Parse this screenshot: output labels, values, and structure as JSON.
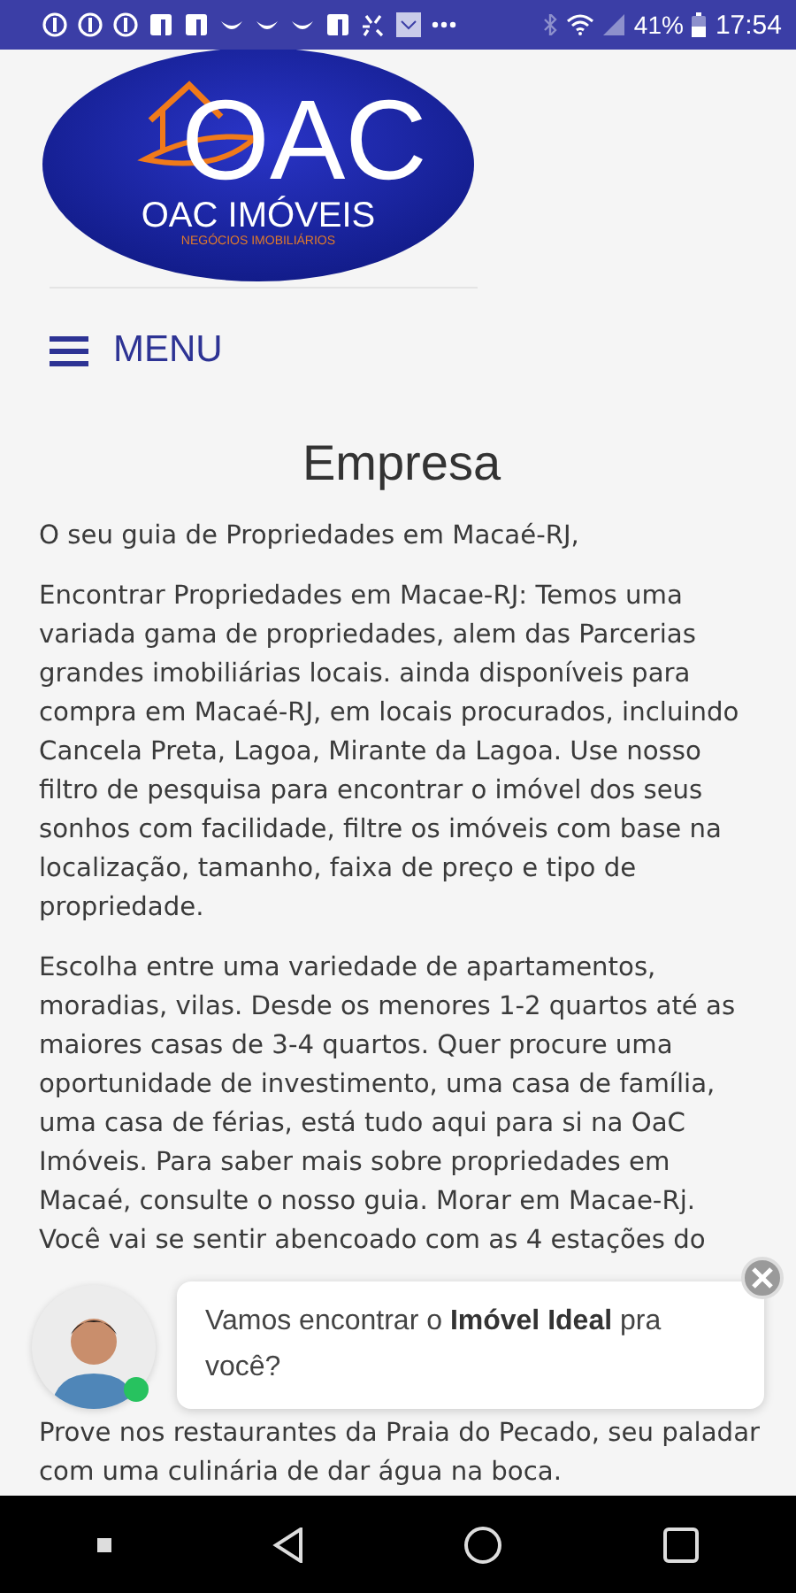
{
  "status_bar": {
    "battery": "41%",
    "time": "17:54"
  },
  "logo": {
    "mark": "OAC",
    "name": "OAC IMÓVEIS",
    "tagline": "NEGÓCIOS IMOBILIÁRIOS"
  },
  "menu": {
    "label": "MENU"
  },
  "page": {
    "title": "Empresa",
    "paragraphs": [
      "O seu guia de Propriedades em Macaé-RJ,",
      "Encontrar Propriedades em Macae-RJ: Temos uma variada gama de propriedades, alem das Parcerias grandes imobiliárias locais. ainda disponíveis para compra em Macaé-RJ, em locais procurados, incluindo Cancela Preta, Lagoa, Mirante da Lagoa. Use nosso filtro de pesquisa para encontrar o imóvel dos seus sonhos com facilidade, filtre os imóveis com base na localização, tamanho, faixa de preço e tipo de propriedade.",
      "Escolha entre uma variedade de apartamentos, moradias, vilas. Desde os menores 1-2 quartos até as maiores casas de 3-4 quartos. Quer procure uma oportunidade de investimento, uma casa de família, uma casa de férias, está tudo aqui para si na OaC Imóveis. Para saber mais sobre propriedades em Macaé, consulte o nosso guia. Morar em Macae-Rj. Você vai se sentir abencoado com as 4 estações do"
    ],
    "after_popup": "Prove nos restaurantes da Praia do Pecado, seu paladar com uma culinária de dar água na boca."
  },
  "chat_popup": {
    "message": "Vamos encontrar o **Imóvel Ideal** pra você?",
    "online": true
  }
}
